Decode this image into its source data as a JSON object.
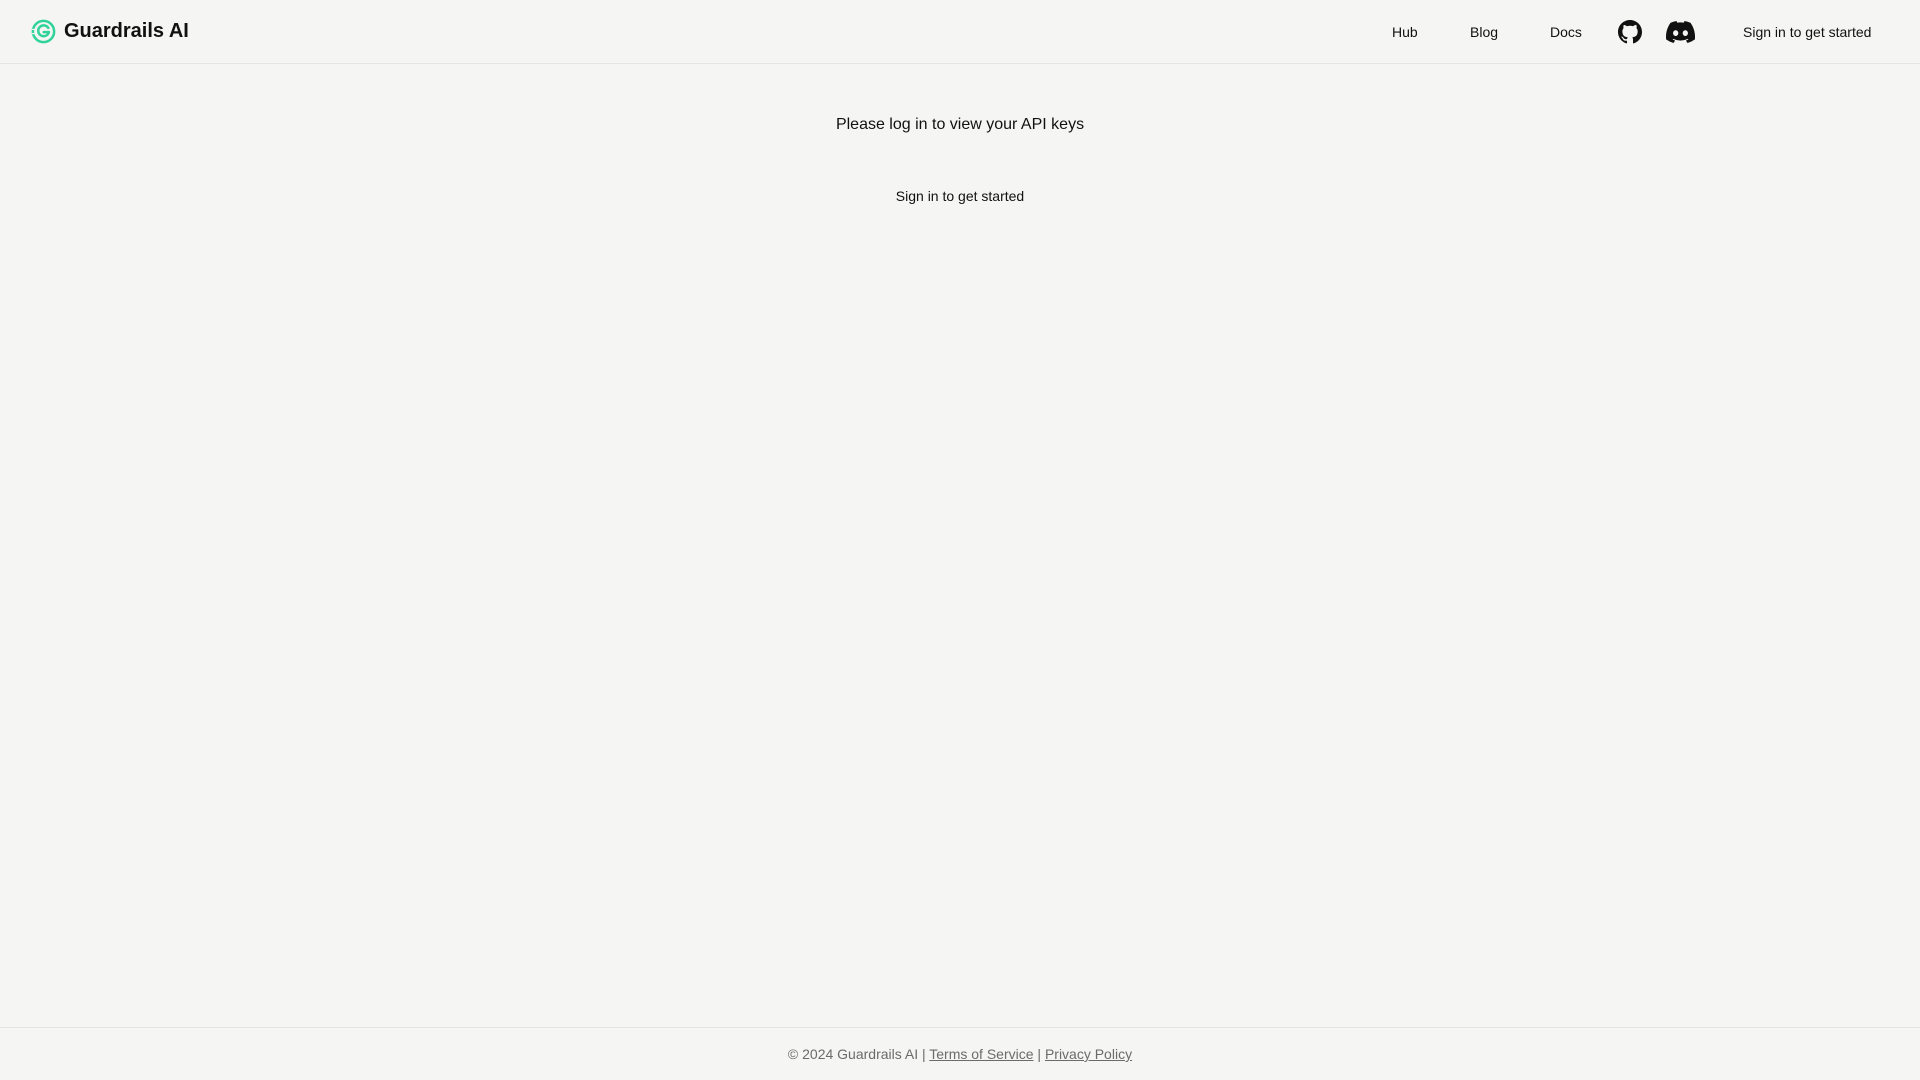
{
  "header": {
    "brand": {
      "name": "Guardrails AI",
      "logo_icon": "guardrails-logo-icon",
      "logo_color": "#2fd39a"
    },
    "nav": [
      {
        "label": "Hub"
      },
      {
        "label": "Blog"
      },
      {
        "label": "Docs"
      }
    ],
    "icons": [
      "github-icon",
      "discord-icon"
    ],
    "signin_label": "Sign in to get started"
  },
  "main": {
    "message": "Please log in to view your API keys",
    "signin_label": "Sign in to get started"
  },
  "footer": {
    "copyright": "© 2024 Guardrails AI",
    "separator": "|",
    "links": [
      {
        "label": "Terms of Service"
      },
      {
        "label": "Privacy Policy"
      }
    ]
  },
  "colors": {
    "background": "#f5f5f3",
    "text": "#111111",
    "muted_text": "#6b6b6b",
    "accent": "#2fd39a"
  }
}
